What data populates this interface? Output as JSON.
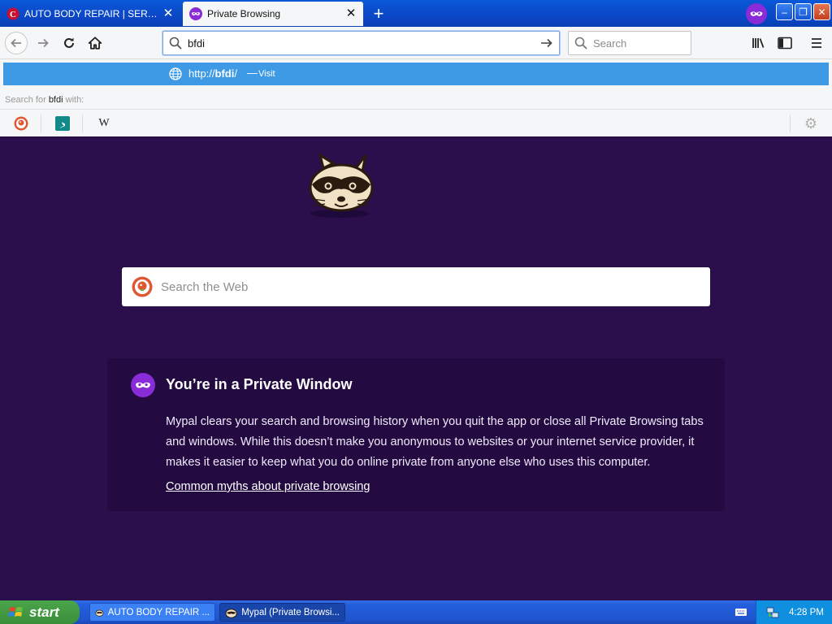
{
  "tabs": [
    {
      "title": "AUTO BODY REPAIR | SERVICES",
      "active": false
    },
    {
      "title": "Private Browsing",
      "active": true
    }
  ],
  "window_controls": {
    "minimize": "‒",
    "restore": "❐",
    "close": "✕"
  },
  "nav": {
    "url_value": "bfdi",
    "search_placeholder": "Search"
  },
  "suggestion": {
    "url_prefix": "http://",
    "url_bold": "bfdi",
    "url_suffix": "/",
    "dash": "—",
    "action": "Visit"
  },
  "search_for": {
    "prefix": "Search for",
    "query": "bfdi",
    "suffix": "with:"
  },
  "engines": [
    "duckduckgo-icon",
    "bing-icon",
    "wikipedia-icon"
  ],
  "wikipedia_glyph": "W",
  "content": {
    "web_search_placeholder": "Search the Web",
    "private_title": "You’re in a Private Window",
    "private_body": "Mypal clears your search and browsing history when you quit the app or close all Private Browsing tabs and windows. While this doesn’t make you anonymous to websites or your internet service provider, it makes it easier to keep what you do online private from anyone else who uses this computer.",
    "myths_link": "Common myths about private browsing"
  },
  "taskbar": {
    "start": "start",
    "tasks": [
      "AUTO BODY REPAIR ...",
      "Mypal (Private Browsi..."
    ],
    "clock": "4:28 PM"
  },
  "colors": {
    "content_bg": "#2a0f4c",
    "private_accent": "#8a2bd8",
    "suggest_highlight": "#3f9ae6"
  }
}
